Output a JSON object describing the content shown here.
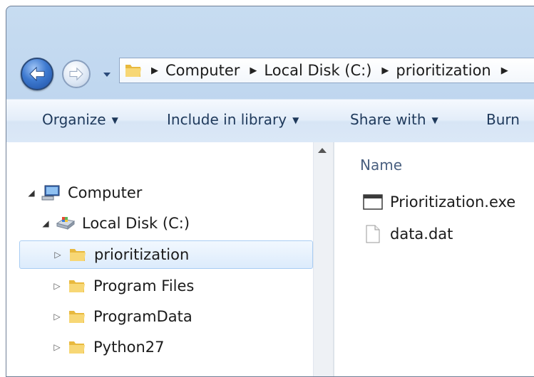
{
  "navigation": {
    "back_icon": "back-arrow-icon",
    "forward_icon": "forward-arrow-icon",
    "history_icon": "chevron-down-icon"
  },
  "address_bar": {
    "crumbs": [
      "Computer",
      "Local Disk (C:)",
      "prioritization"
    ]
  },
  "toolbar": {
    "organize": "Organize",
    "include_in_library": "Include in library",
    "share_with": "Share with",
    "burn": "Burn"
  },
  "tree": {
    "computer": "Computer",
    "local_disk": "Local Disk (C:)",
    "folders": [
      "prioritization",
      "Program Files",
      "ProgramData",
      "Python27"
    ]
  },
  "files": {
    "column_name": "Name",
    "items": [
      "Prioritization.exe",
      "data.dat"
    ]
  }
}
